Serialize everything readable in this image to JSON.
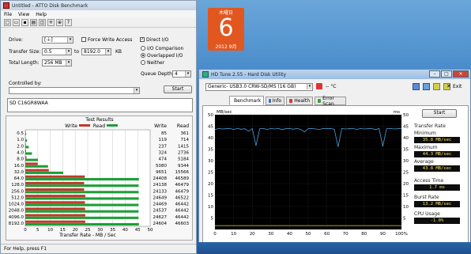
{
  "atto": {
    "title": "Untitled - ATTO Disk Benchmark",
    "menu": [
      "File",
      "View",
      "Help"
    ],
    "drive_label": "Drive:",
    "drive_value": "[-i-]",
    "force_write_label": "Force Write Access",
    "direct_io_label": "Direct I/O",
    "transfer_size_label": "Transfer Size:",
    "transfer_from": "0.5",
    "transfer_to_word": "to",
    "transfer_to": "8192.0",
    "transfer_unit": "KB",
    "total_length_label": "Total Length:",
    "total_length": "256 MB",
    "io_comparison_label": "I/O Comparison",
    "overlapped_label": "Overlapped I/O",
    "neither_label": "Neither",
    "queue_depth_label": "Queue Depth:",
    "queue_depth": "4",
    "controlled_by_label": "Controlled by:",
    "start_label": "Start",
    "device_text": "SD C16GR8WAA",
    "results_title": "Test Results",
    "write_legend": "Write",
    "read_legend": "Read",
    "col_write": "Write",
    "col_read": "Read",
    "x_axis_label": "Transfer Rate - MB / Sec",
    "status": "For Help, press F1"
  },
  "calendar": {
    "header": "木曜日",
    "day": "6",
    "footer": "2012 9月"
  },
  "hdtune": {
    "title": "HD Tune 2.55 - Hard Disk Utility",
    "device": "Generic- USB3.0 CRW-SD/MS (16 GB)",
    "temp": "-- °C",
    "exit_label": "Exit",
    "tabs": [
      "Benchmark",
      "Info",
      "Health",
      "Error Scan"
    ],
    "start_label": "Start",
    "mbsec_label": "MB/sec",
    "ms_label": "ms",
    "transfer_rate_label": "Transfer Rate",
    "minimum_label": "Minimum",
    "minimum": "35.8 MB/sec",
    "maximum_label": "Maximum",
    "maximum": "44.3 MB/sec",
    "average_label": "Average",
    "average": "43.8 MB/sec",
    "access_time_label": "Access Time",
    "access_time": "1.7 ms",
    "burst_rate_label": "Burst Rate",
    "burst_rate": "13.2 MB/sec",
    "cpu_usage_label": "CPU Usage",
    "cpu_usage": "-1.0%"
  },
  "chart_data": [
    {
      "type": "bar",
      "title": "Test Results",
      "xlabel": "Transfer Rate - MB / Sec",
      "xlim": [
        0,
        50
      ],
      "x_ticks": [
        "0",
        "5",
        "10",
        "15",
        "20",
        "25",
        "30",
        "35",
        "40",
        "45",
        "50"
      ],
      "categories": [
        "0.5",
        "1.0",
        "2.0",
        "4.0",
        "8.0",
        "16.0",
        "32.0",
        "64.0",
        "128.0",
        "256.0",
        "512.0",
        "1024.0",
        "2048.0",
        "4096.0",
        "8192.0"
      ],
      "series": [
        {
          "name": "Write",
          "color": "#c0392b",
          "values": [
            85,
            119,
            237,
            324,
            474,
            5080,
            9651,
            24408,
            24138,
            24133,
            24649,
            24469,
            24537,
            24627,
            24604
          ]
        },
        {
          "name": "Read",
          "color": "#1e9e38",
          "values": [
            361,
            714,
            1415,
            2736,
            5184,
            9344,
            15566,
            46589,
            46479,
            46479,
            46522,
            46442,
            46442,
            46442,
            46603
          ]
        }
      ],
      "units": "KB/s"
    },
    {
      "type": "line",
      "xlabel": "",
      "ylabel": "MB/sec",
      "x_ticks": [
        "0",
        "10",
        "20",
        "30",
        "40",
        "50",
        "60",
        "70",
        "80",
        "90",
        "100%"
      ],
      "ylim": [
        0,
        50
      ],
      "y_ticks": [
        "5",
        "10",
        "15",
        "20",
        "25",
        "30",
        "35",
        "40",
        "45",
        "50"
      ],
      "y2lim": [
        0,
        50
      ],
      "y2_ticks": [
        "5",
        "10",
        "15",
        "20",
        "25",
        "30",
        "35",
        "40",
        "45",
        "50"
      ],
      "series": [
        {
          "name": "transfer",
          "color": "#4aa3e0",
          "x": [
            0,
            2,
            4,
            6,
            8,
            10,
            12,
            14,
            16,
            18,
            20,
            22,
            24,
            26,
            28,
            30,
            32,
            34,
            36,
            38,
            40,
            42,
            44,
            46,
            48,
            50,
            52,
            54,
            56,
            58,
            60,
            62,
            64,
            66,
            68,
            70,
            72,
            74,
            76,
            78,
            80,
            82,
            84,
            86,
            88,
            90,
            92,
            94,
            96,
            98,
            100
          ],
          "values": [
            43.5,
            44,
            43.8,
            43.9,
            44,
            43.6,
            44,
            43.7,
            43.9,
            42.8,
            44,
            36.5,
            43.9,
            44,
            43.6,
            44,
            43.8,
            44,
            43.5,
            43.9,
            44,
            43.7,
            44,
            43.6,
            42.5,
            43.9,
            44,
            43.8,
            43.6,
            44,
            43.9,
            44,
            43.7,
            36,
            44,
            43.8,
            43.9,
            44,
            43.6,
            44,
            43.8,
            43.9,
            44,
            43.5,
            44,
            36.2,
            43.9,
            44,
            43.8,
            43.9,
            44
          ]
        },
        {
          "name": "access",
          "color": "#d8d830",
          "x": [
            0,
            10,
            20,
            30,
            40,
            50,
            60,
            70,
            80,
            90,
            100
          ],
          "values": [
            1.7,
            1.7,
            1.7,
            1.7,
            1.7,
            1.7,
            1.7,
            1.7,
            1.7,
            1.7,
            1.7
          ]
        }
      ]
    }
  ]
}
